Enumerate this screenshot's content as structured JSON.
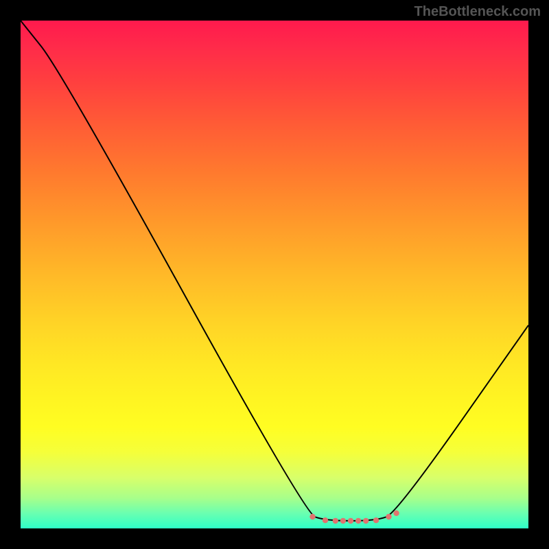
{
  "watermark": "TheBottleneck.com",
  "chart_data": {
    "type": "line",
    "title": "",
    "xlabel": "",
    "ylabel": "",
    "x_range": [
      0,
      100
    ],
    "y_range": [
      0,
      100
    ],
    "series": [
      {
        "name": "curve",
        "points": [
          {
            "x": 0,
            "y": 100
          },
          {
            "x": 8,
            "y": 90
          },
          {
            "x": 56,
            "y": 3
          },
          {
            "x": 60,
            "y": 1.5
          },
          {
            "x": 70,
            "y": 1.5
          },
          {
            "x": 74,
            "y": 3
          },
          {
            "x": 100,
            "y": 40
          }
        ]
      }
    ],
    "markers": [
      {
        "x": 57.5,
        "y": 2.3
      },
      {
        "x": 60.0,
        "y": 1.6
      },
      {
        "x": 62.0,
        "y": 1.5
      },
      {
        "x": 63.5,
        "y": 1.5
      },
      {
        "x": 65.0,
        "y": 1.5
      },
      {
        "x": 66.5,
        "y": 1.5
      },
      {
        "x": 68.0,
        "y": 1.5
      },
      {
        "x": 70.0,
        "y": 1.6
      },
      {
        "x": 72.5,
        "y": 2.3
      },
      {
        "x": 74.0,
        "y": 3.0
      }
    ],
    "notes": "Gradient background from red (high bottleneck) at top to green (low bottleneck) at bottom. V-shaped black curve with minimum plateau around x=60–74. Small salmon/pink circular markers clustered on the plateau."
  }
}
